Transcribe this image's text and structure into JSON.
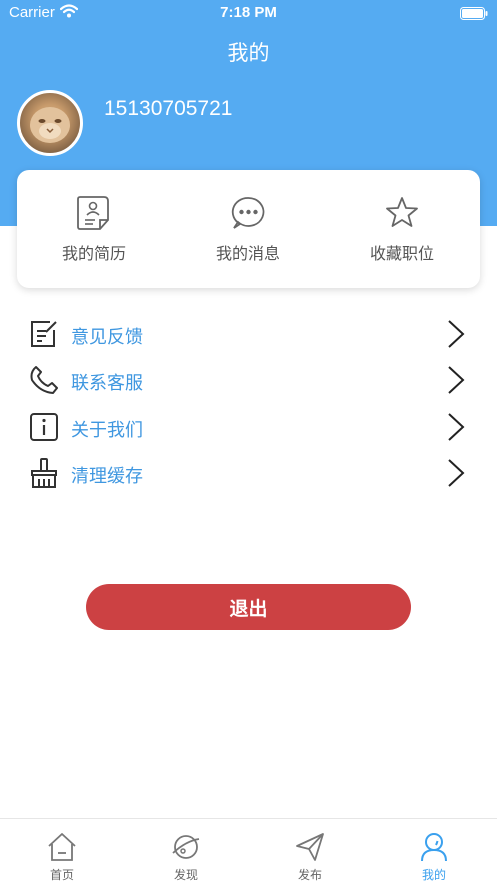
{
  "status_bar": {
    "carrier": "Carrier",
    "time": "7:18 PM"
  },
  "header": {
    "title": "我的"
  },
  "profile": {
    "phone": "15130705721"
  },
  "quick_actions": [
    {
      "label": "我的简历",
      "icon": "resume-icon"
    },
    {
      "label": "我的消息",
      "icon": "message-icon"
    },
    {
      "label": "收藏职位",
      "icon": "star-icon"
    }
  ],
  "menu": [
    {
      "label": "意见反馈",
      "icon": "feedback-icon"
    },
    {
      "label": "联系客服",
      "icon": "phone-icon"
    },
    {
      "label": "关于我们",
      "icon": "info-icon"
    },
    {
      "label": "清理缓存",
      "icon": "broom-icon"
    }
  ],
  "logout_label": "退出",
  "tabs": [
    {
      "label": "首页",
      "icon": "home-icon"
    },
    {
      "label": "发现",
      "icon": "planet-icon"
    },
    {
      "label": "发布",
      "icon": "send-icon"
    },
    {
      "label": "我的",
      "icon": "user-icon",
      "active": true
    }
  ],
  "colors": {
    "primary": "#55abf2",
    "accent": "#3f97e0",
    "logout": "#cc4143"
  }
}
